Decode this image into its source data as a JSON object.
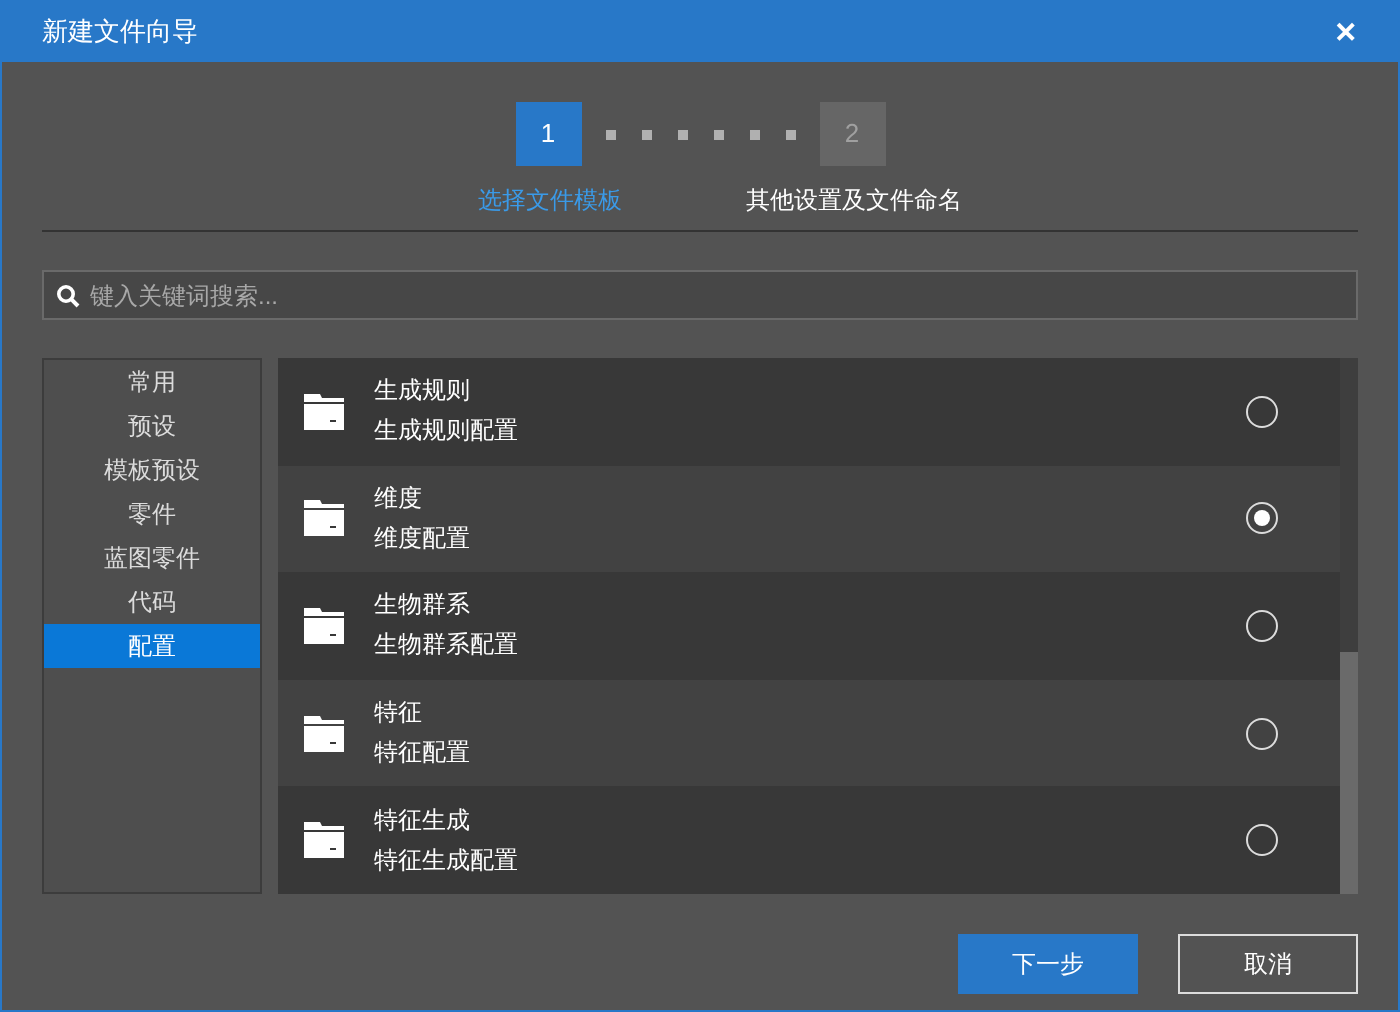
{
  "window": {
    "title": "新建文件向导",
    "close": "✕"
  },
  "steps": [
    {
      "number": "1",
      "label": "选择文件模板",
      "selected": true
    },
    {
      "number": "2",
      "label": "其他设置及文件命名",
      "selected": false
    }
  ],
  "search": {
    "placeholder": "键入关键词搜索..."
  },
  "sidebar": {
    "items": [
      {
        "label": "常用",
        "selected": false
      },
      {
        "label": "预设",
        "selected": false
      },
      {
        "label": "模板预设",
        "selected": false
      },
      {
        "label": "零件",
        "selected": false
      },
      {
        "label": "蓝图零件",
        "selected": false
      },
      {
        "label": "代码",
        "selected": false
      },
      {
        "label": "配置",
        "selected": true
      }
    ]
  },
  "templates": [
    {
      "name": "生成规则",
      "description": "生成规则配置",
      "selected": false
    },
    {
      "name": "维度",
      "description": "维度配置",
      "selected": true
    },
    {
      "name": "生物群系",
      "description": "生物群系配置",
      "selected": false
    },
    {
      "name": "特征",
      "description": "特征配置",
      "selected": false
    },
    {
      "name": "特征生成",
      "description": "特征生成配置",
      "selected": false
    }
  ],
  "buttons": [
    {
      "label": "下一步",
      "kind": "primary"
    },
    {
      "label": "取消",
      "kind": "secondary"
    }
  ]
}
